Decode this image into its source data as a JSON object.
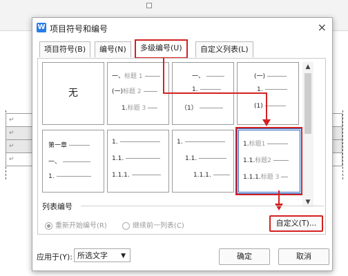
{
  "dialog": {
    "title": "项目符号和编号",
    "app_icon": "W",
    "close_glyph": "×"
  },
  "tabs": [
    {
      "label": "项目符号(B)",
      "active": false
    },
    {
      "label": "编号(N)",
      "active": false
    },
    {
      "label": "多级编号(U)",
      "active": true
    },
    {
      "label": "自定义列表(L)",
      "active": false
    }
  ],
  "gallery": {
    "none_label": "无",
    "cells": [
      {
        "lines": [
          [
            "一、",
            "标题 1"
          ],
          [
            "(一)",
            "标题 2"
          ],
          [
            "1.",
            "标题 3"
          ]
        ]
      },
      {
        "lines": [
          [
            "一、",
            ""
          ],
          [
            "1.",
            ""
          ],
          [
            "（1）",
            ""
          ]
        ]
      },
      {
        "lines": [
          [
            "(一)",
            ""
          ],
          [
            "1.",
            ""
          ],
          [
            "(1)",
            ""
          ]
        ]
      },
      {
        "lines": [
          [
            "第一章",
            ""
          ],
          [
            "一、",
            ""
          ],
          [
            "1.",
            ""
          ]
        ]
      },
      {
        "lines": [
          [
            "1.",
            ""
          ],
          [
            "1.1.",
            ""
          ],
          [
            "1.1.1.",
            ""
          ]
        ]
      },
      {
        "lines": [
          [
            "1.",
            ""
          ],
          [
            "1.1.",
            ""
          ],
          [
            "1.1.1.",
            ""
          ]
        ]
      },
      {
        "lines": [
          [
            "1.",
            "标题1"
          ],
          [
            "1.1.",
            "标题2"
          ],
          [
            "1.1.1.",
            "标题 3"
          ]
        ]
      }
    ]
  },
  "list_numbering": {
    "label": "列表编号",
    "restart": "重新开始编号(R)",
    "continue": "继续前一列表(C)",
    "custom_button": "自定义(T)..."
  },
  "footer": {
    "apply_label": "应用于(Y):",
    "apply_value": "所选文字",
    "ok": "确定",
    "cancel": "取消"
  },
  "colors": {
    "highlight_red": "#d42020",
    "selection_blue": "#2a63c0",
    "app_blue": "#2a7ce8"
  }
}
